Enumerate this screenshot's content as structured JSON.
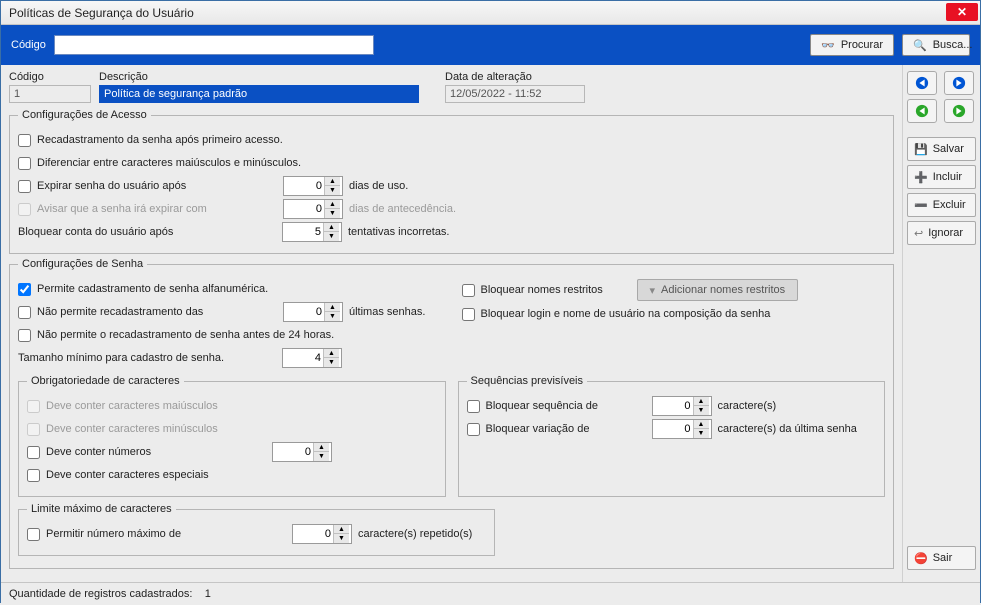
{
  "window": {
    "title": "Políticas de Segurança do Usuário"
  },
  "search": {
    "codigo_label": "Código",
    "codigo_value": "",
    "procurar_label": "Procurar",
    "busca_label": "Busca..."
  },
  "top_fields": {
    "codigo_label": "Código",
    "codigo_value": "1",
    "descricao_label": "Descrição",
    "descricao_value": "Política de segurança padrão",
    "data_label": "Data de alteração",
    "data_value": "12/05/2022 - 11:52"
  },
  "acesso": {
    "legend": "Configurações de Acesso",
    "recadastramento": "Recadastramento da senha após primeiro acesso.",
    "diferenciar": "Diferenciar entre caracteres maiúsculos e minúsculos.",
    "expirar_label": "Expirar senha do usuário após",
    "expirar_valor": "0",
    "expirar_sufixo": "dias de uso.",
    "avisar_label": "Avisar que a senha irá expirar com",
    "avisar_valor": "0",
    "avisar_sufixo": "dias de antecedência.",
    "bloquear_label": "Bloquear conta do usuário após",
    "bloquear_valor": "5",
    "bloquear_sufixo": "tentativas incorretas."
  },
  "senha": {
    "legend": "Configurações de Senha",
    "alfanum": "Permite cadastramento de senha alfanumérica.",
    "naorecad_label": "Não permite recadastramento das",
    "naorecad_valor": "0",
    "naorecad_sufixo": "últimas senhas.",
    "naorecad24": "Não permite o recadastramento de senha antes de 24 horas.",
    "tamanho_label": "Tamanho mínimo para cadastro de senha.",
    "tamanho_valor": "4",
    "bloq_nomes": "Bloquear nomes restritos",
    "add_nomes": "Adicionar nomes restritos",
    "bloq_login": "Bloquear login e nome de usuário na composição da senha",
    "obrig": {
      "legend": "Obrigatoriedade de caracteres",
      "maius": "Deve conter caracteres maiúsculos",
      "minus": "Deve conter caracteres minúsculos",
      "num_label": "Deve conter números",
      "num_valor": "0",
      "espec": "Deve conter caracteres especiais"
    },
    "seq": {
      "legend": "Sequências previsíveis",
      "bloq_seq_label": "Bloquear sequência de",
      "bloq_seq_valor": "0",
      "bloq_seq_sufixo": "caractere(s)",
      "bloq_var_label": "Bloquear variação de",
      "bloq_var_valor": "0",
      "bloq_var_sufixo": "caractere(s) da última senha"
    },
    "limite": {
      "legend": "Limite máximo de caracteres",
      "permitir_label": "Permitir número máximo de",
      "permitir_valor": "0",
      "permitir_sufixo": "caractere(s) repetido(s)"
    }
  },
  "sidebar": {
    "salvar": "Salvar",
    "incluir": "Incluir",
    "excluir": "Excluir",
    "ignorar": "Ignorar",
    "sair": "Sair"
  },
  "status": {
    "label": "Quantidade de registros cadastrados:",
    "valor": "1"
  }
}
